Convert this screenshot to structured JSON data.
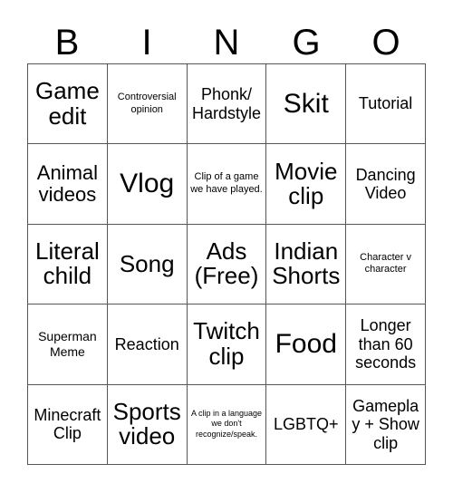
{
  "card": {
    "title": "BINGO",
    "header_letters": [
      "B",
      "I",
      "N",
      "G",
      "O"
    ],
    "grid_size": "5x5",
    "border_color": "#555555",
    "background_color": "#ffffff",
    "text_color": "#000000"
  },
  "rows": [
    {
      "cells": [
        {
          "text": "Game edit",
          "size": "xl"
        },
        {
          "text": "Controversial opinion",
          "size": "xs"
        },
        {
          "text": "Phonk/ Hardstyle",
          "size": "md"
        },
        {
          "text": "Skit",
          "size": "xxl"
        },
        {
          "text": "Tutorial",
          "size": "md"
        }
      ]
    },
    {
      "cells": [
        {
          "text": "Animal videos",
          "size": "lg"
        },
        {
          "text": "Vlog",
          "size": "xxl"
        },
        {
          "text": "Clip of a game we have played.",
          "size": "xs"
        },
        {
          "text": "Movie clip",
          "size": "xl"
        },
        {
          "text": "Dancing Video",
          "size": "md"
        }
      ]
    },
    {
      "cells": [
        {
          "text": "Literal child",
          "size": "xl"
        },
        {
          "text": "Song",
          "size": "xl"
        },
        {
          "text": "Ads (Free)",
          "size": "xl"
        },
        {
          "text": "Indian Shorts",
          "size": "xl"
        },
        {
          "text": "Character v character",
          "size": "xs"
        }
      ]
    },
    {
      "cells": [
        {
          "text": "Superman Meme",
          "size": "sm"
        },
        {
          "text": "Reaction",
          "size": "md"
        },
        {
          "text": "Twitch clip",
          "size": "xl"
        },
        {
          "text": "Food",
          "size": "xxl"
        },
        {
          "text": "Longer than 60 seconds",
          "size": "md"
        }
      ]
    },
    {
      "cells": [
        {
          "text": "Minecraft Clip",
          "size": "md"
        },
        {
          "text": "Sports video",
          "size": "xl"
        },
        {
          "text": "A clip in a language we don't recognize/speak.",
          "size": "xxs"
        },
        {
          "text": "LGBTQ+",
          "size": "md"
        },
        {
          "text": "Gameplay + Show clip",
          "size": "md"
        }
      ]
    }
  ]
}
